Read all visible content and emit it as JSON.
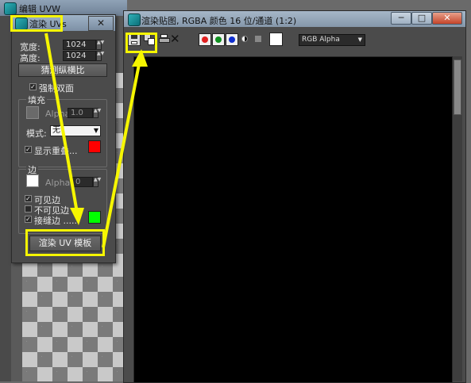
{
  "background_window": {
    "title": "编辑 UVW"
  },
  "render_uvs": {
    "title": "渲染 UVs",
    "close_label": "✕",
    "width_label": "宽度:",
    "width_value": "1024",
    "height_label": "高度:",
    "height_value": "1024",
    "aspect_button": "猜测纵横比",
    "force_2sided_label": "强制双面",
    "fill": {
      "group_label": "填充",
      "alpha_label": "Alpha:",
      "alpha_value": "1.0",
      "mode_label": "模式:",
      "mode_value": "无",
      "show_overlap_label": "显示重叠...",
      "overlap_color": "#ff0000"
    },
    "edge": {
      "group_label": "边",
      "alpha_label": "Alpha:",
      "alpha_value": "0",
      "visible_label": "可见边",
      "invisible_label": "不可见边",
      "seam_label": "接缝边 ......",
      "seam_color": "#00ff00"
    },
    "render_button": "渲染 UV 模板"
  },
  "render_map": {
    "title": "渲染贴图, RGBA 颜色 16 位/通道 (1:2)",
    "min_label": "─",
    "max_label": "□",
    "close_label": "✕",
    "channel_value": "RGB Alpha",
    "channel_colors": {
      "red": "#e02020",
      "green": "#109020",
      "blue": "#1030d0"
    }
  },
  "accent": "#f6f600"
}
